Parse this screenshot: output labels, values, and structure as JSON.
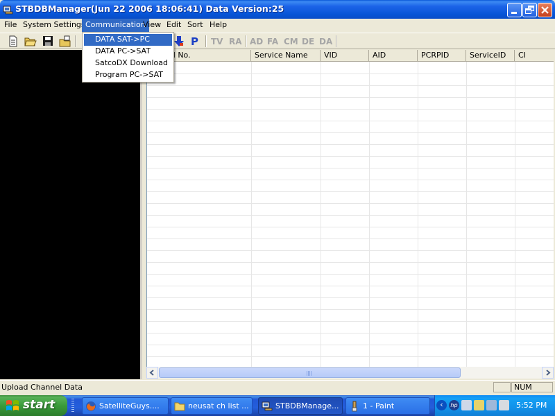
{
  "window": {
    "title": "STBDBManager(Jun 22 2006 18:06:41)  Data Version:25"
  },
  "menubar": {
    "items": [
      "File",
      "System Settings",
      "Communication",
      "View",
      "Edit",
      "Sort",
      "Help"
    ],
    "active": "Communication"
  },
  "dropdown": {
    "items": [
      "DATA SAT->PC",
      "DATA PC->SAT",
      "SatcoDX Download",
      "Program PC->SAT"
    ],
    "selected": "DATA SAT->PC"
  },
  "toolbar": {
    "text_buttons": [
      "P",
      "TV",
      "RA",
      "AD",
      "FA",
      "CM",
      "DE",
      "DA"
    ]
  },
  "grid": {
    "columns": [
      "el No.",
      "Service Name",
      "VID",
      "AID",
      "PCRPID",
      "ServiceID",
      "CI"
    ],
    "rows": []
  },
  "statusbar": {
    "text": "Upload Channel Data",
    "num_indicator": "NUM"
  },
  "taskbar": {
    "start_label": "start",
    "tasks": [
      {
        "label": "SatelliteGuys....",
        "icon": "firefox-icon",
        "active": false
      },
      {
        "label": "neusat ch list ...",
        "icon": "folder-icon",
        "active": false
      },
      {
        "label": "STBDBManage...",
        "icon": "app-icon",
        "active": true
      },
      {
        "label": "1 - Paint",
        "icon": "paint-icon",
        "active": false
      }
    ],
    "clock": "5:52 PM"
  },
  "colors": {
    "titlebar": "#0654d6",
    "menu_highlight": "#316ac5",
    "start_button": "#3a9b3a",
    "left_pane": "#000000"
  }
}
